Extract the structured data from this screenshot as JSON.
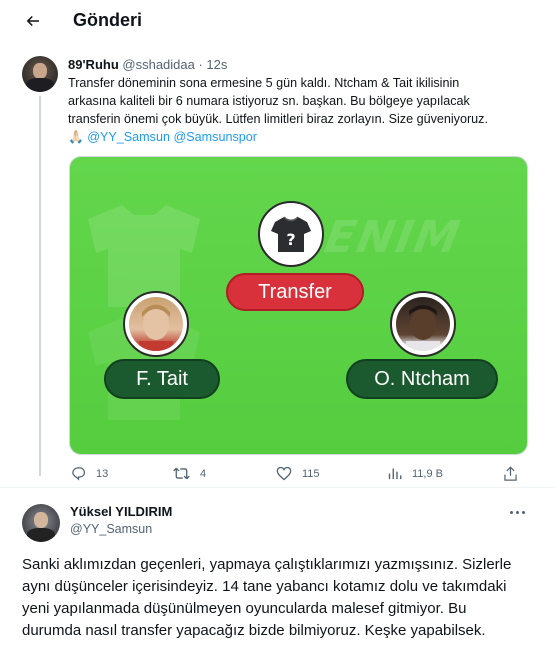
{
  "header": {
    "title": "Gönderi",
    "back_icon": "arrow-left-icon"
  },
  "tweet": {
    "author_name": "89'Ruhu",
    "author_handle": "@sshadidaa",
    "time": "· 12s",
    "text_lines": [
      "Transfer döneminin sona ermesine 5 gün kaldı. Ntcham & Tait ikilisinin",
      "arkasına kaliteli bir 6 numara istiyoruz sn. başkan. Bu bölgeye yapılacak",
      "transferin önemi çok büyük. Lütfen limitleri biraz zorlayın. Size güveniyoruz."
    ],
    "last_line_emoji": "🙏🏻",
    "mentions": "@YY_Samsun @Samsunspor",
    "media": {
      "transfer_label": "Transfer",
      "player_left": "F. Tait",
      "player_right": "O. Ntcham",
      "watermark": "BENIM",
      "pitch_color": "#5ad244",
      "pill_color": "#1b5a2e",
      "transfer_color": "#d9313b"
    },
    "actions": {
      "replies": "13",
      "retweets": "4",
      "likes": "115",
      "views": "11,9 B"
    }
  },
  "reply": {
    "author_name": "Yüksel YILDIRIM",
    "author_handle": "@YY_Samsun",
    "text_lines": [
      "Sanki aklımızdan geçenleri, yapmaya çalıştıklarımızı yazmışsınız. Sizlerle",
      "aynı düşünceler içerisindeyiz. 14 tane yabancı kotamız dolu ve takımdaki",
      "yeni yapılanmada düşünülmeyen oyuncularda malesef gitmiyor. Bu",
      "durumda nasıl transfer yapacağız bizde bilmiyoruz. Keşke yapabilsek."
    ]
  },
  "colors": {
    "text": "#0f1419",
    "secondary": "#536471",
    "link": "#1d9bf0"
  }
}
